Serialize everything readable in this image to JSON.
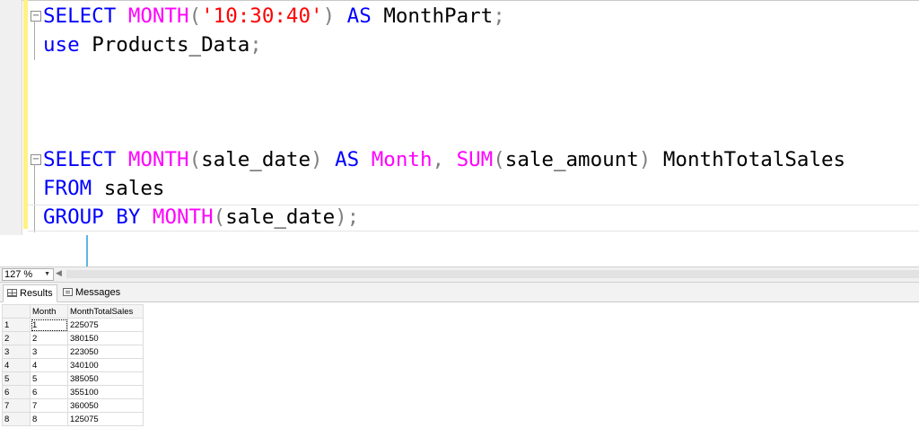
{
  "editor": {
    "lines": [
      [
        {
          "t": "SELECT ",
          "c": "kw"
        },
        {
          "t": "MONTH",
          "c": "fn"
        },
        {
          "t": "(",
          "c": "gr"
        },
        {
          "t": "'10:30:40'",
          "c": "str"
        },
        {
          "t": ")",
          "c": "gr"
        },
        {
          "t": " AS ",
          "c": "kw"
        },
        {
          "t": "MonthPart",
          "c": ""
        },
        {
          "t": ";",
          "c": "gr"
        }
      ],
      [
        {
          "t": "use ",
          "c": "kw"
        },
        {
          "t": "Products_Data",
          "c": ""
        },
        {
          "t": ";",
          "c": "gr"
        }
      ],
      [],
      [],
      [],
      [
        {
          "t": "SELECT ",
          "c": "kw"
        },
        {
          "t": "MONTH",
          "c": "fn"
        },
        {
          "t": "(",
          "c": "gr"
        },
        {
          "t": "sale_date",
          "c": ""
        },
        {
          "t": ")",
          "c": "gr"
        },
        {
          "t": " AS ",
          "c": "kw"
        },
        {
          "t": "Month",
          "c": "fn"
        },
        {
          "t": ", ",
          "c": "gr"
        },
        {
          "t": "SUM",
          "c": "fn"
        },
        {
          "t": "(",
          "c": "gr"
        },
        {
          "t": "sale_amount",
          "c": ""
        },
        {
          "t": ")",
          "c": "gr"
        },
        {
          "t": " MonthTotalSales",
          "c": ""
        }
      ],
      [
        {
          "t": "FROM ",
          "c": "kw"
        },
        {
          "t": "sales",
          "c": ""
        }
      ],
      [
        {
          "t": "GROUP BY ",
          "c": "kw"
        },
        {
          "t": "MONTH",
          "c": "fn"
        },
        {
          "t": "(",
          "c": "gr"
        },
        {
          "t": "sale_date",
          "c": ""
        },
        {
          "t": ")",
          "c": "gr"
        },
        {
          "t": ";",
          "c": "gr"
        }
      ]
    ]
  },
  "status": {
    "zoom": "127 %"
  },
  "tabs": {
    "results": "Results",
    "messages": "Messages"
  },
  "results": {
    "columns": [
      "Month",
      "MonthTotalSales"
    ],
    "rows": [
      [
        "1",
        "1",
        "225075"
      ],
      [
        "2",
        "2",
        "380150"
      ],
      [
        "3",
        "3",
        "223050"
      ],
      [
        "4",
        "4",
        "340100"
      ],
      [
        "5",
        "5",
        "385050"
      ],
      [
        "6",
        "6",
        "355100"
      ],
      [
        "7",
        "7",
        "360050"
      ],
      [
        "8",
        "8",
        "125075"
      ]
    ]
  },
  "icons": {
    "fold": "collapse-minus-icon",
    "results_tab": "grid-icon",
    "messages_tab": "messages-icon",
    "annotation": "arrow-down-icon"
  },
  "colors": {
    "keyword": "#0000ff",
    "function": "#ff00ff",
    "string": "#ff0000",
    "operator": "#808080",
    "change_bar": "#fff285",
    "annotation_arrow": "#5fb4e8"
  }
}
